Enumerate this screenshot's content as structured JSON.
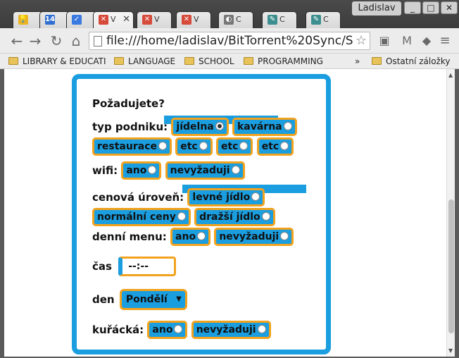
{
  "browser": {
    "user": "Ladislav",
    "tabs": [
      {
        "icon": "bulb-icon",
        "label": "",
        "color": "#e9b324"
      },
      {
        "icon": "calendar-icon",
        "label": "14",
        "color": "#2f6fd1"
      },
      {
        "icon": "check-mail-icon",
        "label": "",
        "color": "#3a7ae0"
      },
      {
        "icon": "page-icon",
        "label": "V",
        "color": "#d64a3a"
      },
      {
        "icon": "page-icon",
        "label": "V",
        "color": "#d64a3a"
      },
      {
        "icon": "page-icon",
        "label": "V",
        "color": "#d64a3a"
      },
      {
        "icon": "c-icon",
        "label": "C",
        "color": "#777777"
      },
      {
        "icon": "pencil-icon",
        "label": "C",
        "color": "#3d8f8f"
      },
      {
        "icon": "pencil-icon",
        "label": "C",
        "color": "#3d8f8f"
      }
    ],
    "url": "file:///home/ladislav/BitTorrent%20Sync/Stra",
    "bookmarks": [
      "LIBRARY & EDUCATI",
      "LANGUAGE",
      "SCHOOL",
      "PROGRAMMING"
    ],
    "bookmarks_more": "»",
    "other_bookmarks": "Ostatní záložky"
  },
  "form": {
    "title": "Požadujete?",
    "business_type": {
      "label": "typ podniku:",
      "options": [
        "jídelna",
        "kavárna",
        "restaurace",
        "etc",
        "etc",
        "etc"
      ],
      "selected": "jídelna"
    },
    "wifi": {
      "label": "wifi:",
      "options": [
        "ano",
        "nevyžaduji"
      ]
    },
    "price_level": {
      "label": "cenová úroveň:",
      "options": [
        "levné jídlo",
        "normální ceny",
        "dražší jídlo"
      ]
    },
    "daily_menu": {
      "label": "denní menu:",
      "options": [
        "ano",
        "nevyžaduji"
      ]
    },
    "time": {
      "label": "čas",
      "value": "--:--"
    },
    "day": {
      "label": "den",
      "value": "Pondělí"
    },
    "smoking": {
      "label": "kuřácká:",
      "options": [
        "ano",
        "nevyžaduji"
      ]
    }
  },
  "colors": {
    "accent": "#1a9ee0",
    "option_border": "#f2a21c"
  }
}
